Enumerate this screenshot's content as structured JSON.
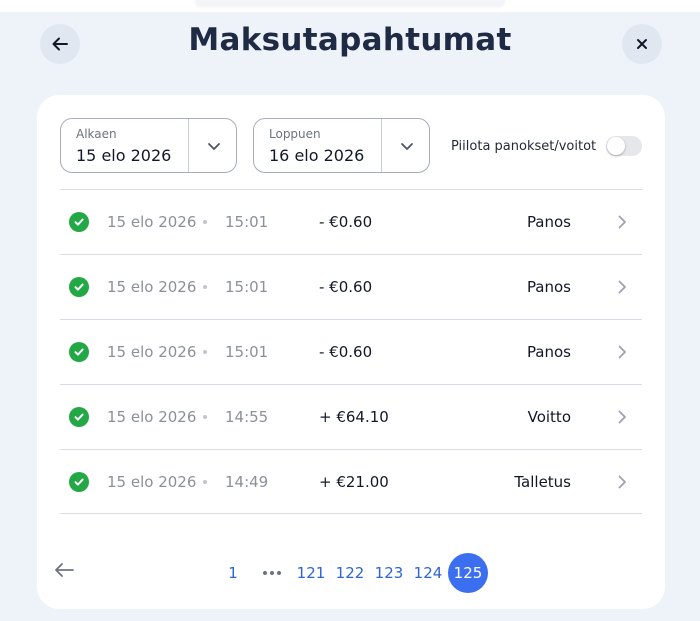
{
  "header": {
    "title": "Maksutapahtumat",
    "back_icon": "arrow-left-icon",
    "close_icon": "close-icon"
  },
  "filters": {
    "start": {
      "label": "Alkaen",
      "value": "15 elo 2026"
    },
    "end": {
      "label": "Loppuen",
      "value": "16 elo 2026"
    },
    "toggle_label": "Piilota panokset/voitot",
    "toggle_on": false
  },
  "transactions": [
    {
      "date": "15 elo 2026",
      "time": "15:01",
      "amount": "- €0.60",
      "type": "Panos",
      "status": "success"
    },
    {
      "date": "15 elo 2026",
      "time": "15:01",
      "amount": "- €0.60",
      "type": "Panos",
      "status": "success"
    },
    {
      "date": "15 elo 2026",
      "time": "15:01",
      "amount": "- €0.60",
      "type": "Panos",
      "status": "success"
    },
    {
      "date": "15 elo 2026",
      "time": "14:55",
      "amount": "+ €64.10",
      "type": "Voitto",
      "status": "success"
    },
    {
      "date": "15 elo 2026",
      "time": "14:49",
      "amount": "+ €21.00",
      "type": "Talletus",
      "status": "success"
    }
  ],
  "pagination": {
    "first": "1",
    "pages": [
      "121",
      "122",
      "123",
      "124"
    ],
    "current": "125"
  },
  "colors": {
    "background": "#eef2f9",
    "success": "#22a845",
    "link": "#2e64d8",
    "active_page": "#3b6ff0"
  }
}
